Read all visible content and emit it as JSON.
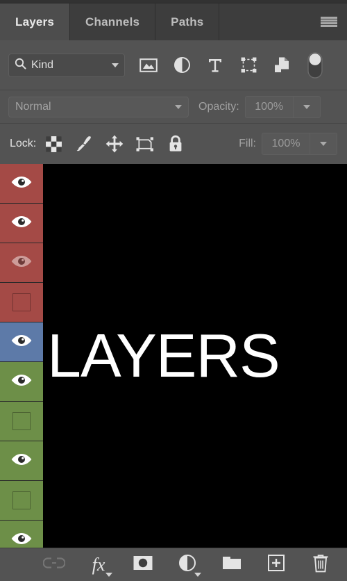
{
  "panel": {
    "tabs": [
      {
        "label": "Layers",
        "active": true
      },
      {
        "label": "Channels",
        "active": false
      },
      {
        "label": "Paths",
        "active": false
      }
    ],
    "menu_icon": "hamburger-menu-icon"
  },
  "filter": {
    "kind_label": "Kind",
    "search_icon": "search-icon",
    "dropdown_icon": "chevron-down-icon",
    "type_filters": [
      {
        "name": "pixel-layer-filter-icon"
      },
      {
        "name": "adjustment-layer-filter-icon"
      },
      {
        "name": "type-layer-filter-icon"
      },
      {
        "name": "shape-layer-filter-icon"
      },
      {
        "name": "smart-object-filter-icon"
      }
    ],
    "toggle": {
      "name": "filter-enable-toggle",
      "state": "on"
    }
  },
  "blend": {
    "mode": "Normal",
    "mode_dropdown_icon": "chevron-down-icon",
    "opacity_label": "Opacity:",
    "opacity_value": "100%",
    "opacity_stepper_icon": "chevron-down-icon"
  },
  "lock": {
    "label": "Lock:",
    "buttons": [
      {
        "name": "lock-transparent-pixels-icon"
      },
      {
        "name": "lock-image-pixels-icon"
      },
      {
        "name": "lock-position-icon"
      },
      {
        "name": "lock-artboard-nesting-icon"
      },
      {
        "name": "lock-all-icon"
      }
    ],
    "fill_label": "Fill:",
    "fill_value": "100%",
    "fill_stepper_icon": "chevron-down-icon"
  },
  "layers": [
    {
      "color": "#a44a46",
      "color_name": "red",
      "visible": true,
      "eye_dim": false
    },
    {
      "color": "#a44a46",
      "color_name": "red",
      "visible": true,
      "eye_dim": false
    },
    {
      "color": "#a44a46",
      "color_name": "red",
      "visible": true,
      "eye_dim": true
    },
    {
      "color": "#a44a46",
      "color_name": "red",
      "visible": false,
      "eye_dim": false
    },
    {
      "color": "#5d7aa8",
      "color_name": "blue",
      "visible": true,
      "eye_dim": false
    },
    {
      "color": "#6d8f48",
      "color_name": "green",
      "visible": true,
      "eye_dim": false
    },
    {
      "color": "#6d8f48",
      "color_name": "green",
      "visible": false,
      "eye_dim": false
    },
    {
      "color": "#6d8f48",
      "color_name": "green",
      "visible": true,
      "eye_dim": false
    },
    {
      "color": "#6d8f48",
      "color_name": "green",
      "visible": false,
      "eye_dim": false
    },
    {
      "color": "#6d8f48",
      "color_name": "green",
      "visible": true,
      "eye_dim": false
    }
  ],
  "canvas": {
    "text": "LAYERS",
    "background": "#000000",
    "text_color": "#ffffff"
  },
  "bottom_toolbar": [
    {
      "name": "link-layers-button",
      "icon": "link-icon",
      "disabled": true
    },
    {
      "name": "layer-style-button",
      "icon": "fx-icon",
      "label": "fx",
      "disabled": false
    },
    {
      "name": "add-layer-mask-button",
      "icon": "layer-mask-icon",
      "disabled": false
    },
    {
      "name": "new-adjustment-layer-button",
      "icon": "adjustment-circle-icon",
      "disabled": false
    },
    {
      "name": "new-group-button",
      "icon": "folder-icon",
      "disabled": false
    },
    {
      "name": "new-layer-button",
      "icon": "new-layer-plus-icon",
      "disabled": false
    },
    {
      "name": "delete-layer-button",
      "icon": "trash-icon",
      "disabled": false
    }
  ],
  "colors": {
    "panel_bg": "#535353",
    "tab_bg": "#3d3d3d",
    "tab_active_bg": "#4d4d4d",
    "text": "#e0e0e0",
    "muted_text": "#a0a0a0",
    "red_layer": "#a44a46",
    "blue_layer": "#5d7aa8",
    "green_layer": "#6d8f48"
  }
}
